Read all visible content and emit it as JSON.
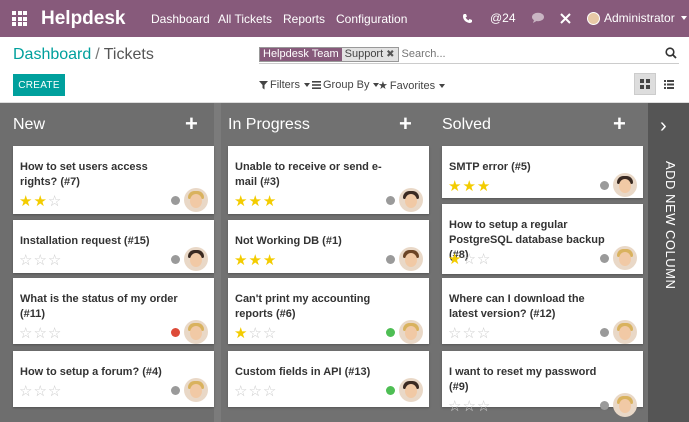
{
  "topbar": {
    "brand": "Helpdesk",
    "menu": [
      "Dashboard",
      "All Tickets",
      "Reports",
      "Configuration"
    ],
    "phone_icon": "phone-icon",
    "mentions_count": "@24",
    "chat_icon": "chat-icon",
    "tools_icon": "tools-icon",
    "user": "Administrator",
    "accent": "#875a7b"
  },
  "breadcrumb": {
    "parent": "Dashboard",
    "separator": "/",
    "current": "Tickets"
  },
  "create_label": "CREATE",
  "search": {
    "facet_title": "Helpdesk Team",
    "facet_value": "Support",
    "facet_close": "✖",
    "placeholder": "Search..."
  },
  "filters": {
    "filters": "Filters",
    "group_by": "Group By",
    "favorites": "Favorites"
  },
  "add_symbol": "+",
  "columns": [
    {
      "name": "New",
      "cards": [
        {
          "title": "How to set users access rights? (#7)",
          "stars": 2,
          "state": "grey",
          "avatar": "blonde"
        },
        {
          "title": "Installation request (#15)",
          "stars": 0,
          "state": "grey",
          "avatar": "dark"
        },
        {
          "title": "What is the status of my order (#11)",
          "stars": 0,
          "state": "red",
          "avatar": "blonde"
        },
        {
          "title": "How to setup a forum? (#4)",
          "stars": 0,
          "state": "grey",
          "avatar": "blonde"
        }
      ]
    },
    {
      "name": "In Progress",
      "cards": [
        {
          "title": "Unable to receive or send e-mail (#3)",
          "stars": 3,
          "state": "grey",
          "avatar": "dark"
        },
        {
          "title": "Not Working DB (#1)",
          "stars": 3,
          "state": "grey",
          "avatar": "brown"
        },
        {
          "title": "Can't print my accounting reports (#6)",
          "stars": 1,
          "state": "green",
          "avatar": "blonde"
        },
        {
          "title": "Custom fields in API (#13)",
          "stars": 0,
          "state": "green",
          "avatar": "dark"
        }
      ]
    },
    {
      "name": "Solved",
      "cards": [
        {
          "title": "SMTP error (#5)",
          "stars": 3,
          "state": "grey",
          "avatar": "dark"
        },
        {
          "title": "How to setup a regular PostgreSQL database backup (#8)",
          "stars": 1,
          "state": "grey",
          "avatar": "blonde"
        },
        {
          "title": "Where can I download the latest version? (#12)",
          "stars": 0,
          "state": "grey",
          "avatar": "blonde"
        },
        {
          "title": "I want to reset my password (#9)",
          "stars": 0,
          "state": "grey",
          "avatar": "blonde"
        }
      ]
    }
  ],
  "add_column": {
    "chevron": "›",
    "label": "ADD NEW COLUMN"
  },
  "colors": {
    "state_grey": "#9a9a9a",
    "state_green": "#4ebe54",
    "state_red": "#dd4b39",
    "star_on": "#f3cc00",
    "star_off": "#cccccc"
  }
}
